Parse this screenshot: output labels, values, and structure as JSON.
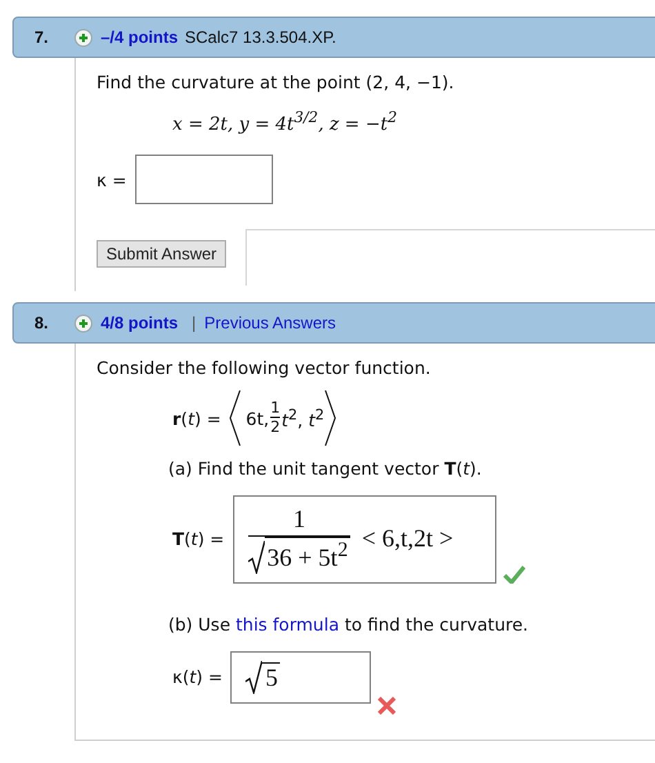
{
  "questions": [
    {
      "number": "7.",
      "points": "–/4 points",
      "source": "SCalc7 13.3.504.XP.",
      "items": [
        {
          "kind": "text",
          "text": "Find the curvature at the point  (2, 4, −1)."
        },
        {
          "kind": "formula",
          "text": "x = 2t, y = 4t$^{3/2}$, z = −t$^{2}$"
        },
        {
          "kind": "blank",
          "label": "κ ="
        },
        {
          "kind": "submit",
          "label": "Submit Answer"
        }
      ]
    },
    {
      "number": "8.",
      "points": "4/8 points",
      "separator": "|",
      "link": "Previous Answers",
      "items": [
        {
          "kind": "text",
          "text": "Consider the following vector function."
        },
        {
          "kind": "vector",
          "label": "**r**(*t*) =",
          "first": "6t,",
          "numerator": "1",
          "denominator": "2",
          "rest": "*t*$^{2}$, *t*$^{2}$"
        },
        {
          "kind": "part",
          "text": "(a) Find the unit tangent vector **T**(*t*)."
        },
        {
          "kind": "answer",
          "label": "**T**(*t*) =",
          "numerator": "1",
          "radicand": "36 + 5t$^{2}$",
          "after": "< 6,t,2t >",
          "correct": true
        },
        {
          "kind": "linktext",
          "before": "(b) Use ",
          "link": "this formula",
          "after": " to find the curvature."
        },
        {
          "kind": "answer",
          "label": "κ(*t*) =",
          "radicand": "5",
          "correct": false
        }
      ]
    }
  ]
}
